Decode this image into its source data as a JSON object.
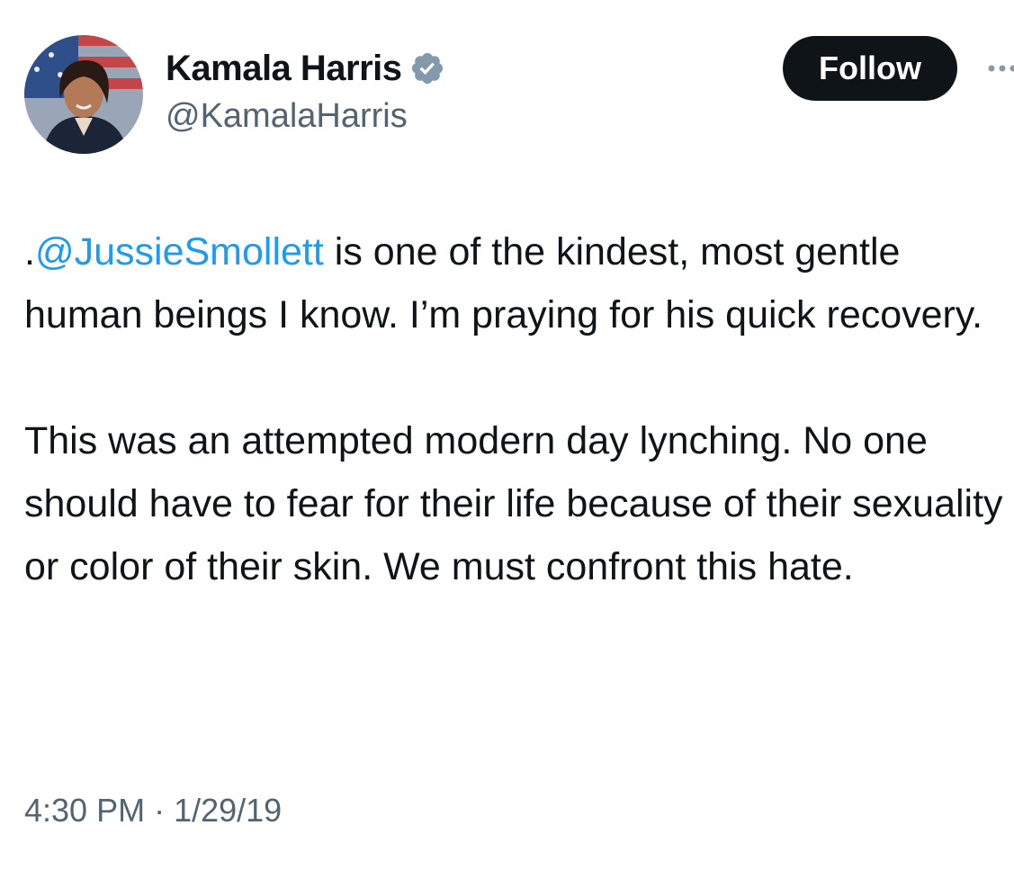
{
  "author": {
    "display_name": "Kamala Harris",
    "handle": "@KamalaHarris",
    "verified_icon": "verified-badge-icon",
    "avatar_icon": "profile-photo"
  },
  "actions": {
    "follow_label": "Follow",
    "more_icon": "more-options-icon"
  },
  "tweet": {
    "mention_prefix": ".",
    "mention": "@JussieSmollett",
    "paragraph1_rest": " is one of the kindest, most gentle human beings I know. I’m praying for his quick recovery.",
    "paragraph2": "This was an attempted modern day lynching. No one should have to fear for their life because of their sexuality or color of their skin. We must confront this hate."
  },
  "meta": {
    "time": "4:30 PM",
    "separator": "·",
    "date": "1/29/19"
  },
  "colors": {
    "text": "#0f1419",
    "secondary_text": "#536471",
    "link": "#1d9bf0",
    "button_bg": "#0f1419",
    "verified_badge": "#829aab"
  }
}
